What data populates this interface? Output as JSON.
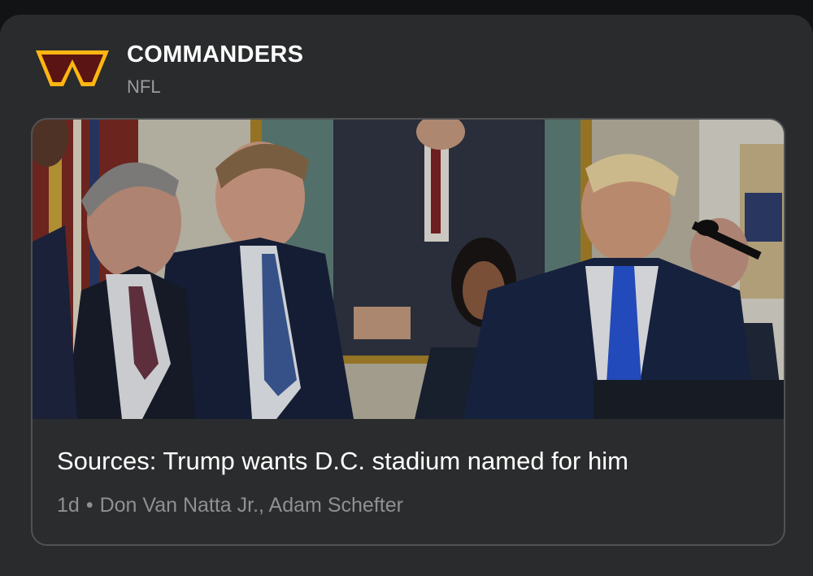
{
  "team": {
    "name": "COMMANDERS",
    "league": "NFL",
    "logo_letter": "W",
    "brand_colors": {
      "burgundy": "#5a1414",
      "gold": "#ffb612"
    }
  },
  "story": {
    "headline": "Sources: Trump wants D.C. stadium named for him",
    "age": "1d",
    "separator": "•",
    "authors": "Don Van Natta Jr., Adam Schefter",
    "image_alt": "Men in suits at the White House"
  },
  "theme": {
    "background": "#121314",
    "card": "#2a2b2c",
    "border": "#505254",
    "muted_text": "#8e9092"
  }
}
